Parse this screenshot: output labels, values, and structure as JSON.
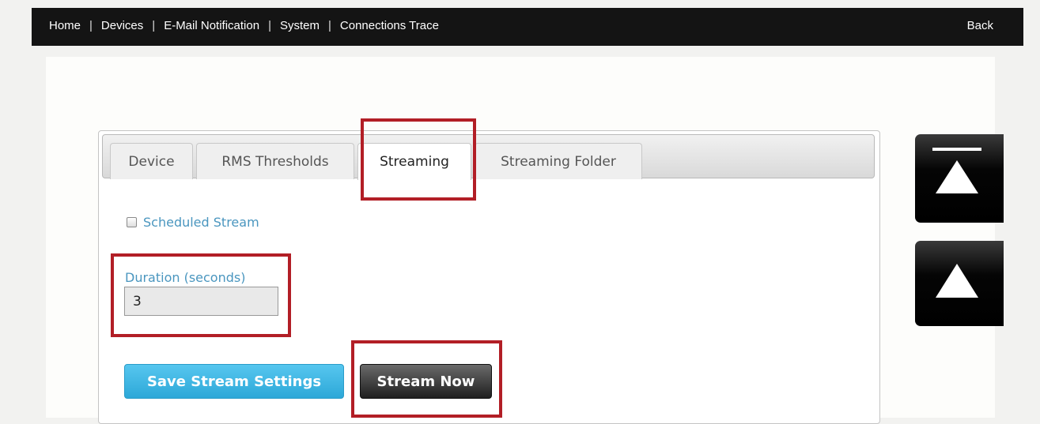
{
  "nav": {
    "items": [
      {
        "label": "Home"
      },
      {
        "label": "Devices"
      },
      {
        "label": "E-Mail Notification"
      },
      {
        "label": "System"
      },
      {
        "label": "Connections Trace"
      }
    ],
    "separator": "|",
    "back_label": "Back"
  },
  "tabs": [
    {
      "label": "Device",
      "active": false
    },
    {
      "label": "RMS Thresholds",
      "active": false
    },
    {
      "label": "Streaming",
      "active": true
    },
    {
      "label": "Streaming Folder",
      "active": false
    }
  ],
  "streaming": {
    "scheduled_label": "Scheduled Stream",
    "scheduled_checked": false,
    "duration_label": "Duration (seconds)",
    "duration_value": "3",
    "save_label": "Save Stream Settings",
    "stream_now_label": "Stream Now"
  },
  "side_buttons": [
    {
      "icon": "scroll-to-top-icon"
    },
    {
      "icon": "scroll-up-icon"
    }
  ],
  "colors": {
    "nav_bg": "#141414",
    "link_blue": "#4a96bf",
    "save_button": "#3bb4e2",
    "stream_button": "#2a2a2a",
    "highlight": "#b21e26"
  }
}
